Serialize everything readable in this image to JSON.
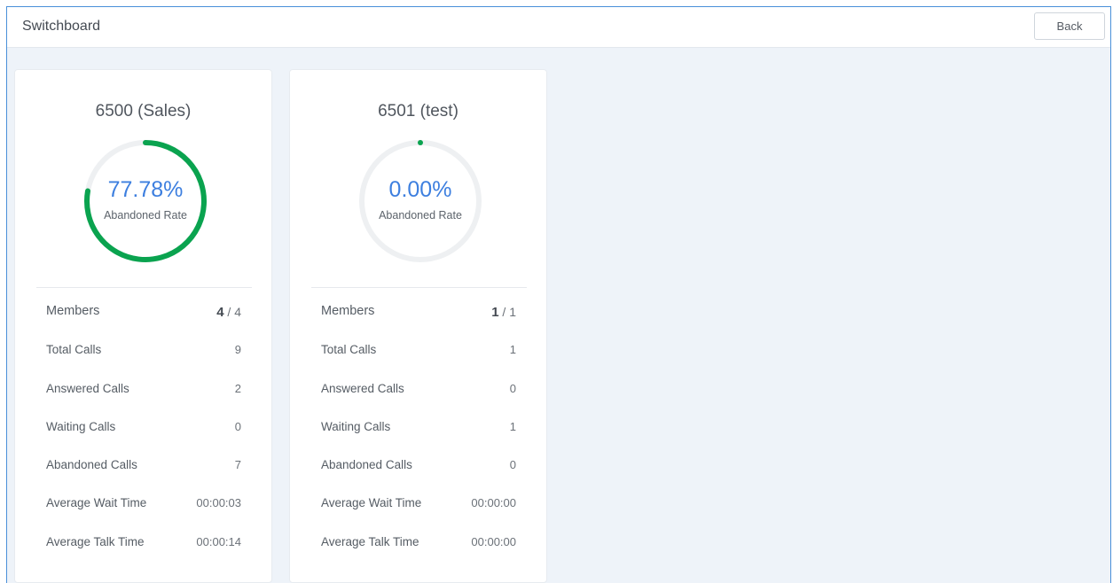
{
  "header": {
    "title": "Switchboard",
    "back_label": "Back"
  },
  "colors": {
    "accent_green": "#0aa34f",
    "accent_blue": "#3d7fdf",
    "track_gray": "#eef0f2"
  },
  "queues": [
    {
      "title": "6500 (Sales)",
      "abandoned_rate_value": 77.78,
      "abandoned_rate_text": "77.78%",
      "abandoned_rate_label": "Abandoned Rate",
      "members_label": "Members",
      "members_online": "4",
      "members_total": "/ 4",
      "stats": [
        {
          "label": "Total Calls",
          "value": "9"
        },
        {
          "label": "Answered Calls",
          "value": "2"
        },
        {
          "label": "Waiting Calls",
          "value": "0"
        },
        {
          "label": "Abandoned Calls",
          "value": "7"
        },
        {
          "label": "Average Wait Time",
          "value": "00:00:03"
        },
        {
          "label": "Average Talk Time",
          "value": "00:00:14"
        }
      ]
    },
    {
      "title": "6501 (test)",
      "abandoned_rate_value": 0,
      "abandoned_rate_text": "0.00%",
      "abandoned_rate_label": "Abandoned Rate",
      "members_label": "Members",
      "members_online": "1",
      "members_total": "/ 1",
      "stats": [
        {
          "label": "Total Calls",
          "value": "1"
        },
        {
          "label": "Answered Calls",
          "value": "0"
        },
        {
          "label": "Waiting Calls",
          "value": "1"
        },
        {
          "label": "Abandoned Calls",
          "value": "0"
        },
        {
          "label": "Average Wait Time",
          "value": "00:00:00"
        },
        {
          "label": "Average Talk Time",
          "value": "00:00:00"
        }
      ]
    }
  ]
}
